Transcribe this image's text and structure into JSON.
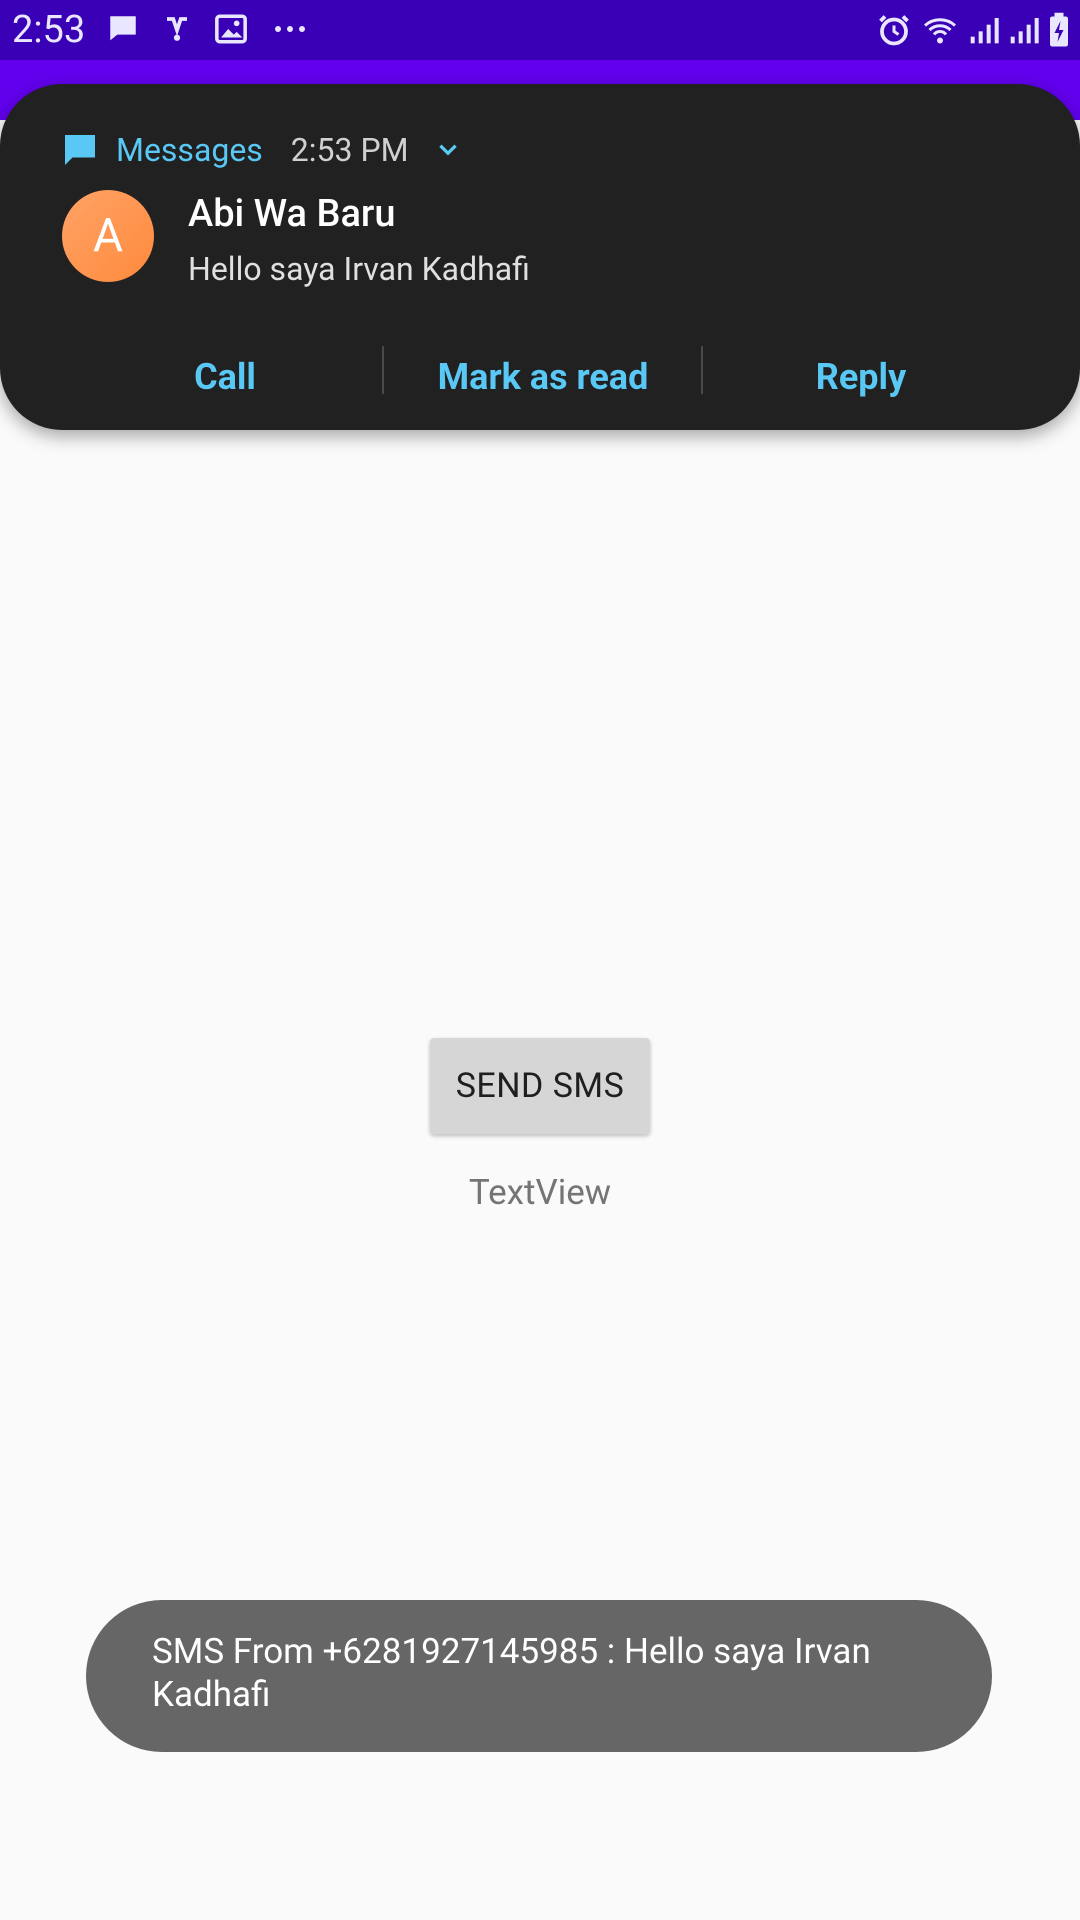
{
  "status_bar": {
    "time": "2:53",
    "left_icons": [
      "message-icon",
      "voicemail-icon",
      "image-icon",
      "more-icon"
    ],
    "right_icons": [
      "alarm-icon",
      "wifi-icon",
      "signal-icon",
      "signal-icon",
      "battery-icon"
    ]
  },
  "notification": {
    "app_name": "Messages",
    "time": "2:53 PM",
    "avatar_letter": "A",
    "sender": "Abi Wa Baru",
    "message": "Hello saya Irvan Kadhafi",
    "actions": [
      {
        "label": "Call"
      },
      {
        "label": "Mark as read"
      },
      {
        "label": "Reply"
      }
    ]
  },
  "main": {
    "send_button_label": "SEND SMS",
    "textview": "TextView"
  },
  "toast": {
    "text": "SMS From +6281927145985 : Hello saya Irvan Kadhafi"
  },
  "colors": {
    "status_bar": "#3a00b5",
    "app_bar": "#6200ee",
    "notification_bg": "#212121",
    "accent": "#5ac8f5",
    "avatar": "#ff8a3d"
  }
}
